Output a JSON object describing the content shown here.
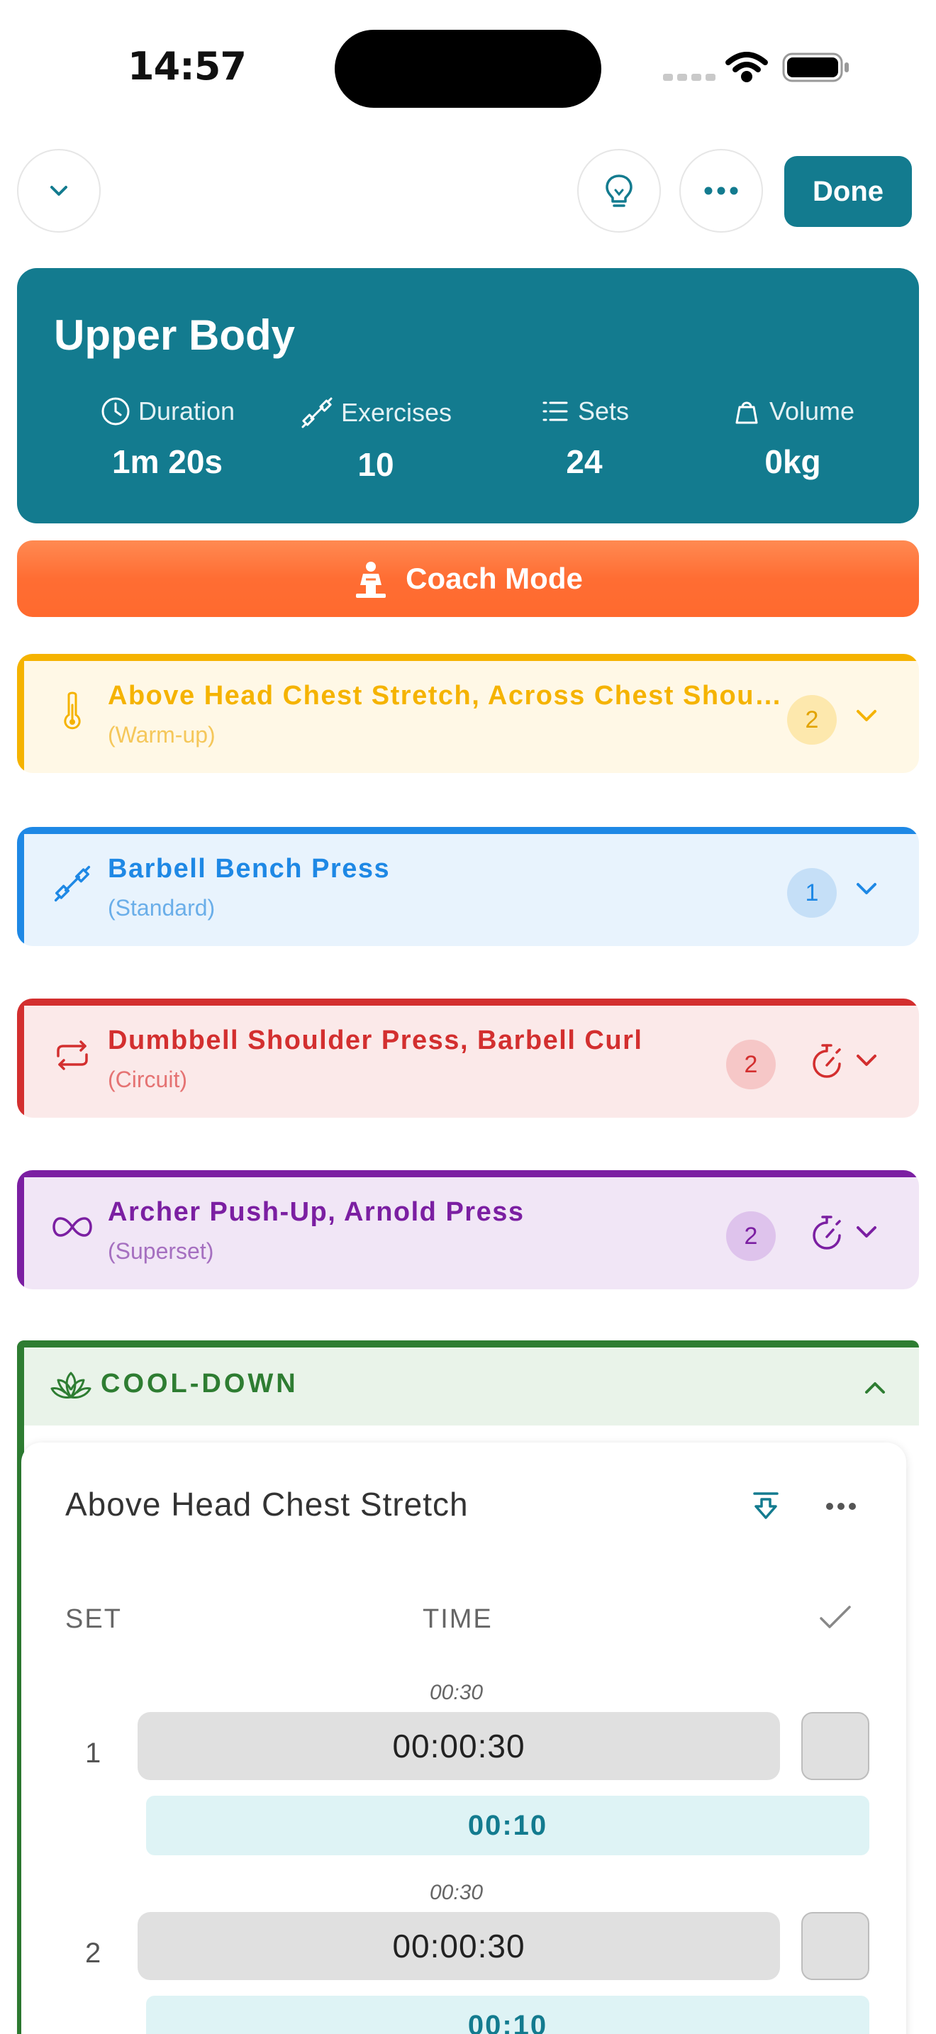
{
  "status_bar": {
    "time": "14:57"
  },
  "toolbar": {
    "done_label": "Done"
  },
  "summary": {
    "title": "Upper Body",
    "stats": [
      {
        "label": "Duration",
        "value": "1m 20s",
        "icon": "clock-icon"
      },
      {
        "label": "Exercises",
        "value": "10",
        "icon": "dumbbell-icon"
      },
      {
        "label": "Sets",
        "value": "24",
        "icon": "list-icon"
      },
      {
        "label": "Volume",
        "value": "0kg",
        "icon": "weight-icon"
      }
    ]
  },
  "coach": {
    "label": "Coach Mode"
  },
  "blocks": [
    {
      "title": "Above Head Chest Stretch, Across Chest Shoulder Stretch",
      "type": "(Warm-up)",
      "count": "2",
      "icon": "thermometer-icon",
      "color": "#f5b300",
      "bg": "#fff8e6"
    },
    {
      "title": "Barbell Bench Press",
      "type": "(Standard)",
      "count": "1",
      "icon": "dumbbell-icon",
      "color": "#1e88e5",
      "bg": "#e8f3fd"
    },
    {
      "title": "Dumbbell Shoulder Press, Barbell Curl",
      "type": "(Circuit)",
      "count": "2",
      "icon": "repeat-icon",
      "color": "#d32f2f",
      "bg": "#fbe9e9"
    },
    {
      "title": "Archer Push-Up, Arnold Press",
      "type": "(Superset)",
      "count": "2",
      "icon": "infinity-icon",
      "color": "#7b1fa2",
      "bg": "#f1e6f6"
    }
  ],
  "cooldown": {
    "title": "COOL-DOWN",
    "icon": "lotus-icon",
    "color": "#2e7d32",
    "exercise": {
      "name": "Above Head Chest Stretch",
      "columns": {
        "set": "SET",
        "time": "TIME"
      },
      "sets": [
        {
          "number": "1",
          "hint": "00:30",
          "time": "00:00:30",
          "rest": "00:10"
        },
        {
          "number": "2",
          "hint": "00:30",
          "time": "00:00:30",
          "rest": "00:10"
        }
      ]
    }
  }
}
